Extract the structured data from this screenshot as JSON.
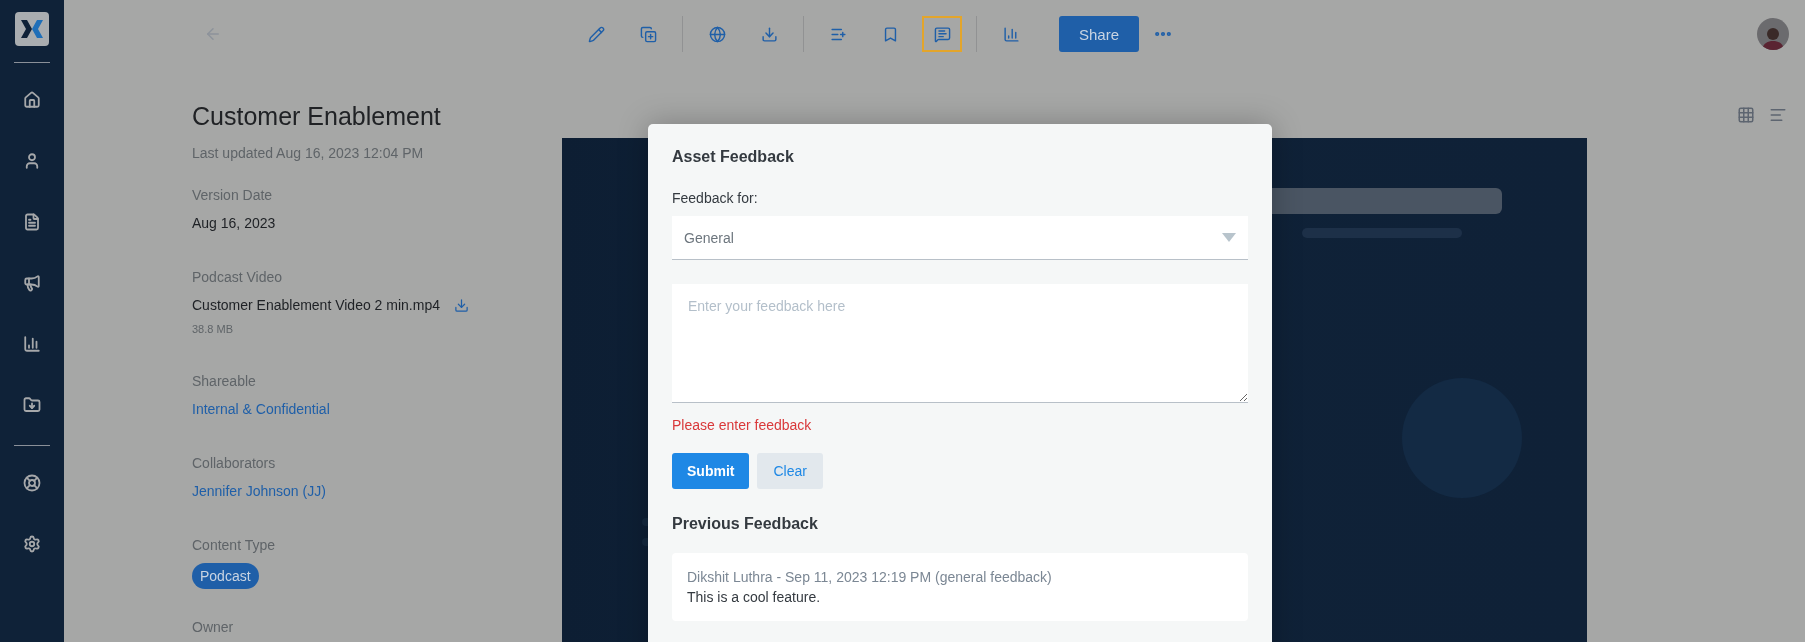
{
  "sidebar": {
    "items": [
      {
        "kind": "home"
      },
      {
        "kind": "user"
      },
      {
        "kind": "document"
      },
      {
        "kind": "megaphone"
      },
      {
        "kind": "chart"
      },
      {
        "kind": "folder"
      },
      {
        "kind": "divider"
      },
      {
        "kind": "lifebuoy"
      },
      {
        "kind": "settings"
      }
    ]
  },
  "toolbar": {
    "groups": [
      [
        {
          "kind": "edit",
          "selected": false
        },
        {
          "kind": "copy",
          "selected": false
        }
      ],
      [
        {
          "kind": "globe",
          "selected": false
        },
        {
          "kind": "download",
          "selected": false
        }
      ],
      [
        {
          "kind": "playlist",
          "selected": false
        },
        {
          "kind": "bookmark",
          "selected": false
        },
        {
          "kind": "feedback",
          "selected": true
        }
      ],
      [
        {
          "kind": "chart",
          "selected": false
        }
      ]
    ],
    "share": "Share"
  },
  "details": {
    "title": "Customer Enablement",
    "last_updated": "Last updated Aug 16, 2023 12:04 PM",
    "fields": [
      {
        "kind": "text",
        "label": "Version Date",
        "value": "Aug 16, 2023"
      },
      {
        "kind": "file",
        "label": "Podcast Video",
        "value": "Customer Enablement Video 2 min.mp4",
        "size": "38.8 MB"
      },
      {
        "kind": "link",
        "label": "Shareable",
        "value": "Internal & Confidential"
      },
      {
        "kind": "link",
        "label": "Collaborators",
        "value": "Jennifer Johnson (JJ)"
      },
      {
        "kind": "chip",
        "label": "Content Type",
        "value": "Podcast"
      },
      {
        "kind": "empty",
        "label": "Owner"
      }
    ]
  },
  "modal": {
    "title": "Asset Feedback",
    "feedback_for_label": "Feedback for:",
    "feedback_for": "General",
    "feedback_placeholder": "Enter your feedback here",
    "error": "Please enter feedback",
    "submit": "Submit",
    "clear": "Clear",
    "previous_title": "Previous Feedback",
    "previous": [
      {
        "meta": "Dikshit Luthra - Sep 11, 2023 12:19 PM (general feedback)",
        "text": "This is a cool feature."
      }
    ]
  }
}
